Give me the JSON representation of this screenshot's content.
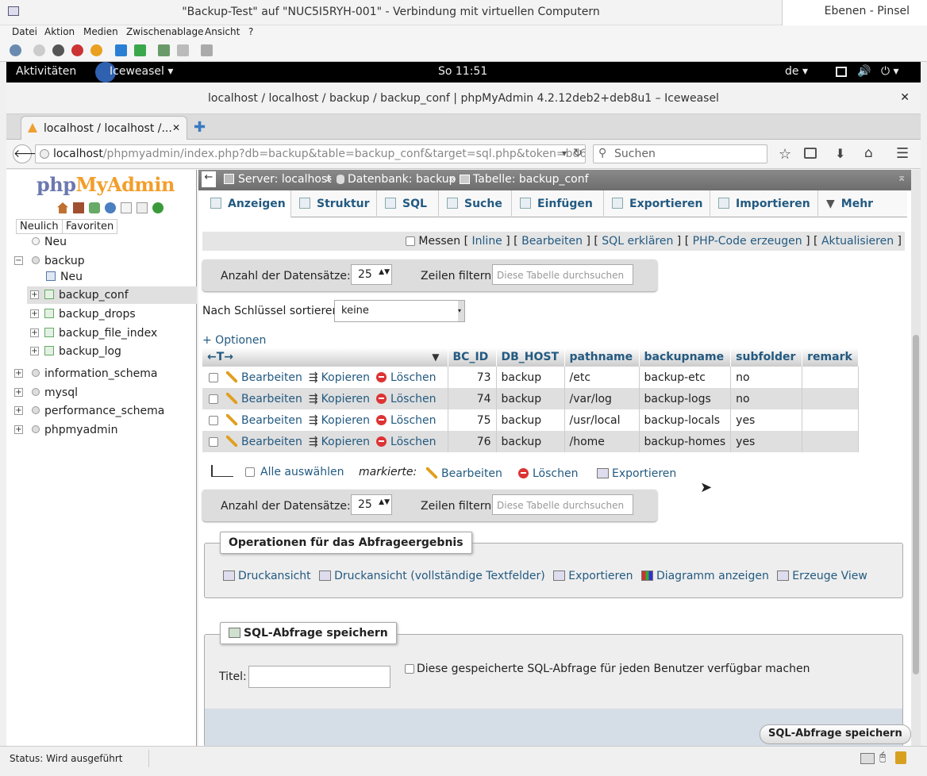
{
  "host": {
    "title": "\"Backup-Test\" auf \"NUC5I5RYH-001\" - Verbindung mit virtuellen Computern",
    "side_app": "Ebenen - Pinsel",
    "menu": [
      "Datei",
      "Aktion",
      "Medien",
      "Zwischenablage",
      "Ansicht",
      "?"
    ],
    "status": "Status: Wird ausgeführt"
  },
  "gnome": {
    "activities": "Aktivitäten",
    "app": "Iceweasel",
    "clock": "So 11:51",
    "lang": "de"
  },
  "browser": {
    "window_title": "localhost / localhost / backup / backup_conf | phpMyAdmin 4.2.12deb2+deb8u1 – Iceweasel",
    "tab_label": "localhost / localhost /...",
    "url_host": "localhost",
    "url_path": "/phpmyadmin/index.php?db=backup&table=backup_conf&target=sql.php&token=bd698",
    "search_placeholder": "Suchen"
  },
  "sidebar": {
    "logo_php": "php",
    "logo_myadmin": "MyAdmin",
    "tabs": [
      "Neulich",
      "Favoriten"
    ],
    "root_new": "Neu",
    "databases": [
      {
        "name": "backup"
      },
      {
        "name": "information_schema"
      },
      {
        "name": "mysql"
      },
      {
        "name": "performance_schema"
      },
      {
        "name": "phpmyadmin"
      }
    ],
    "backup_new": "Neu",
    "backup_tables": [
      "backup_conf",
      "backup_drops",
      "backup_file_index",
      "backup_log"
    ]
  },
  "breadcrumb": {
    "server": "Server: localhost",
    "database": "Datenbank: backup",
    "table": "Tabelle: backup_conf"
  },
  "tabs": [
    "Anzeigen",
    "Struktur",
    "SQL",
    "Suche",
    "Einfügen",
    "Exportieren",
    "Importieren",
    "Mehr"
  ],
  "query_bar": {
    "messen": "Messen",
    "inline": "Inline",
    "bearbeiten": "Bearbeiten",
    "sql_erklaeren": "SQL erklären",
    "php_code": "PHP-Code erzeugen",
    "aktualisieren": "Aktualisieren"
  },
  "nav": {
    "rows_label": "Anzahl der Datensätze:",
    "rows_value": "25",
    "filter_label": "Zeilen filtern:",
    "filter_placeholder": "Diese Tabelle durchsuchen",
    "sort_label": "Nach Schlüssel sortieren:",
    "sort_value": "keine",
    "options": "+ Optionen"
  },
  "table": {
    "columns": [
      "BC_ID",
      "DB_HOST",
      "pathname",
      "backupname",
      "subfolder",
      "remark"
    ],
    "actions": {
      "edit": "Bearbeiten",
      "copy": "Kopieren",
      "delete": "Löschen"
    },
    "rows": [
      {
        "id": "73",
        "host": "backup",
        "path": "/etc",
        "name": "backup-etc",
        "sub": "no",
        "remark": ""
      },
      {
        "id": "74",
        "host": "backup",
        "path": "/var/log",
        "name": "backup-logs",
        "sub": "no",
        "remark": ""
      },
      {
        "id": "75",
        "host": "backup",
        "path": "/usr/local",
        "name": "backup-locals",
        "sub": "yes",
        "remark": ""
      },
      {
        "id": "76",
        "host": "backup",
        "path": "/home",
        "name": "backup-homes",
        "sub": "yes",
        "remark": ""
      }
    ]
  },
  "bulk": {
    "select_all": "Alle auswählen",
    "marked": "markierte:",
    "edit": "Bearbeiten",
    "delete": "Löschen",
    "export": "Exportieren"
  },
  "operations": {
    "legend": "Operationen für das Abfrageergebnis",
    "print": "Druckansicht",
    "print_full": "Druckansicht (vollständige Textfelder)",
    "export": "Exportieren",
    "chart": "Diagramm anzeigen",
    "view": "Erzeuge View"
  },
  "bookmark": {
    "legend": "SQL-Abfrage speichern",
    "title_label": "Titel:",
    "shared_label": "Diese gespeicherte SQL-Abfrage für jeden Benutzer verfügbar machen",
    "submit": "SQL-Abfrage speichern"
  }
}
